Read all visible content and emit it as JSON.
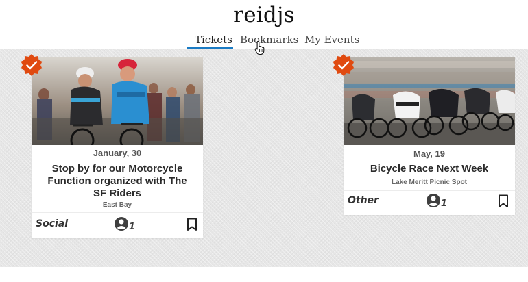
{
  "app": {
    "title": "reidjs"
  },
  "tabs": [
    {
      "label": "Tickets",
      "active": true
    },
    {
      "label": "Bookmarks",
      "active": false
    },
    {
      "label": "My Events",
      "active": false
    }
  ],
  "colors": {
    "accent": "#1a7bc4",
    "badge": "#e04a10",
    "background": "#e6e6e6"
  },
  "events": [
    {
      "date": "January, 30",
      "title": "Stop by for our Motorcycle Function organized with The SF Riders",
      "location": "East Bay",
      "category": "Social",
      "attendees": "1",
      "ticketed": true,
      "icons": {
        "badge": "check-badge-icon",
        "attendees": "user-circle-icon",
        "bookmark": "bookmark-icon"
      }
    },
    {
      "date": "May, 19",
      "title": "Bicycle Race Next Week",
      "location": "Lake Meritt Picnic Spot",
      "category": "Other",
      "attendees": "1",
      "ticketed": true,
      "icons": {
        "badge": "check-badge-icon",
        "attendees": "user-circle-icon",
        "bookmark": "bookmark-icon"
      }
    }
  ]
}
